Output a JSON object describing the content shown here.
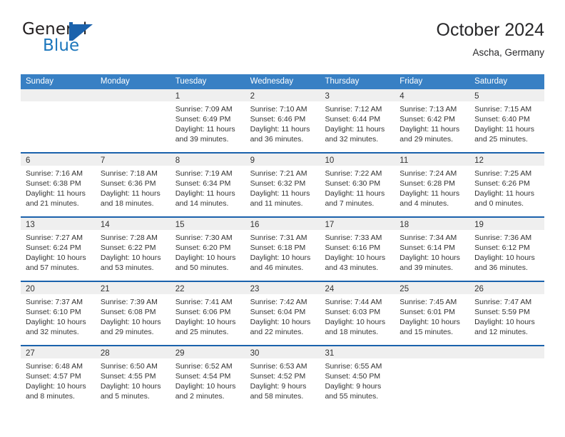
{
  "brand": {
    "name_part1": "General",
    "name_part2": "Blue",
    "logo_icon": "blue-triangle-logo",
    "accent_color": "#1b76bc"
  },
  "header": {
    "title": "October 2024",
    "subtitle": "Ascha, Germany"
  },
  "colors": {
    "header_row_bg": "#3880c4",
    "row_divider": "#1b62ac",
    "day_band_bg": "#efefef",
    "text": "#333333"
  },
  "calendar": {
    "weekdays": [
      "Sunday",
      "Monday",
      "Tuesday",
      "Wednesday",
      "Thursday",
      "Friday",
      "Saturday"
    ],
    "weeks": [
      [
        {
          "day": "",
          "empty": true
        },
        {
          "day": "",
          "empty": true
        },
        {
          "day": "1",
          "sunrise": "Sunrise: 7:09 AM",
          "sunset": "Sunset: 6:49 PM",
          "daylight_1": "Daylight: 11 hours",
          "daylight_2": "and 39 minutes."
        },
        {
          "day": "2",
          "sunrise": "Sunrise: 7:10 AM",
          "sunset": "Sunset: 6:46 PM",
          "daylight_1": "Daylight: 11 hours",
          "daylight_2": "and 36 minutes."
        },
        {
          "day": "3",
          "sunrise": "Sunrise: 7:12 AM",
          "sunset": "Sunset: 6:44 PM",
          "daylight_1": "Daylight: 11 hours",
          "daylight_2": "and 32 minutes."
        },
        {
          "day": "4",
          "sunrise": "Sunrise: 7:13 AM",
          "sunset": "Sunset: 6:42 PM",
          "daylight_1": "Daylight: 11 hours",
          "daylight_2": "and 29 minutes."
        },
        {
          "day": "5",
          "sunrise": "Sunrise: 7:15 AM",
          "sunset": "Sunset: 6:40 PM",
          "daylight_1": "Daylight: 11 hours",
          "daylight_2": "and 25 minutes."
        }
      ],
      [
        {
          "day": "6",
          "sunrise": "Sunrise: 7:16 AM",
          "sunset": "Sunset: 6:38 PM",
          "daylight_1": "Daylight: 11 hours",
          "daylight_2": "and 21 minutes."
        },
        {
          "day": "7",
          "sunrise": "Sunrise: 7:18 AM",
          "sunset": "Sunset: 6:36 PM",
          "daylight_1": "Daylight: 11 hours",
          "daylight_2": "and 18 minutes."
        },
        {
          "day": "8",
          "sunrise": "Sunrise: 7:19 AM",
          "sunset": "Sunset: 6:34 PM",
          "daylight_1": "Daylight: 11 hours",
          "daylight_2": "and 14 minutes."
        },
        {
          "day": "9",
          "sunrise": "Sunrise: 7:21 AM",
          "sunset": "Sunset: 6:32 PM",
          "daylight_1": "Daylight: 11 hours",
          "daylight_2": "and 11 minutes."
        },
        {
          "day": "10",
          "sunrise": "Sunrise: 7:22 AM",
          "sunset": "Sunset: 6:30 PM",
          "daylight_1": "Daylight: 11 hours",
          "daylight_2": "and 7 minutes."
        },
        {
          "day": "11",
          "sunrise": "Sunrise: 7:24 AM",
          "sunset": "Sunset: 6:28 PM",
          "daylight_1": "Daylight: 11 hours",
          "daylight_2": "and 4 minutes."
        },
        {
          "day": "12",
          "sunrise": "Sunrise: 7:25 AM",
          "sunset": "Sunset: 6:26 PM",
          "daylight_1": "Daylight: 11 hours",
          "daylight_2": "and 0 minutes."
        }
      ],
      [
        {
          "day": "13",
          "sunrise": "Sunrise: 7:27 AM",
          "sunset": "Sunset: 6:24 PM",
          "daylight_1": "Daylight: 10 hours",
          "daylight_2": "and 57 minutes."
        },
        {
          "day": "14",
          "sunrise": "Sunrise: 7:28 AM",
          "sunset": "Sunset: 6:22 PM",
          "daylight_1": "Daylight: 10 hours",
          "daylight_2": "and 53 minutes."
        },
        {
          "day": "15",
          "sunrise": "Sunrise: 7:30 AM",
          "sunset": "Sunset: 6:20 PM",
          "daylight_1": "Daylight: 10 hours",
          "daylight_2": "and 50 minutes."
        },
        {
          "day": "16",
          "sunrise": "Sunrise: 7:31 AM",
          "sunset": "Sunset: 6:18 PM",
          "daylight_1": "Daylight: 10 hours",
          "daylight_2": "and 46 minutes."
        },
        {
          "day": "17",
          "sunrise": "Sunrise: 7:33 AM",
          "sunset": "Sunset: 6:16 PM",
          "daylight_1": "Daylight: 10 hours",
          "daylight_2": "and 43 minutes."
        },
        {
          "day": "18",
          "sunrise": "Sunrise: 7:34 AM",
          "sunset": "Sunset: 6:14 PM",
          "daylight_1": "Daylight: 10 hours",
          "daylight_2": "and 39 minutes."
        },
        {
          "day": "19",
          "sunrise": "Sunrise: 7:36 AM",
          "sunset": "Sunset: 6:12 PM",
          "daylight_1": "Daylight: 10 hours",
          "daylight_2": "and 36 minutes."
        }
      ],
      [
        {
          "day": "20",
          "sunrise": "Sunrise: 7:37 AM",
          "sunset": "Sunset: 6:10 PM",
          "daylight_1": "Daylight: 10 hours",
          "daylight_2": "and 32 minutes."
        },
        {
          "day": "21",
          "sunrise": "Sunrise: 7:39 AM",
          "sunset": "Sunset: 6:08 PM",
          "daylight_1": "Daylight: 10 hours",
          "daylight_2": "and 29 minutes."
        },
        {
          "day": "22",
          "sunrise": "Sunrise: 7:41 AM",
          "sunset": "Sunset: 6:06 PM",
          "daylight_1": "Daylight: 10 hours",
          "daylight_2": "and 25 minutes."
        },
        {
          "day": "23",
          "sunrise": "Sunrise: 7:42 AM",
          "sunset": "Sunset: 6:04 PM",
          "daylight_1": "Daylight: 10 hours",
          "daylight_2": "and 22 minutes."
        },
        {
          "day": "24",
          "sunrise": "Sunrise: 7:44 AM",
          "sunset": "Sunset: 6:03 PM",
          "daylight_1": "Daylight: 10 hours",
          "daylight_2": "and 18 minutes."
        },
        {
          "day": "25",
          "sunrise": "Sunrise: 7:45 AM",
          "sunset": "Sunset: 6:01 PM",
          "daylight_1": "Daylight: 10 hours",
          "daylight_2": "and 15 minutes."
        },
        {
          "day": "26",
          "sunrise": "Sunrise: 7:47 AM",
          "sunset": "Sunset: 5:59 PM",
          "daylight_1": "Daylight: 10 hours",
          "daylight_2": "and 12 minutes."
        }
      ],
      [
        {
          "day": "27",
          "sunrise": "Sunrise: 6:48 AM",
          "sunset": "Sunset: 4:57 PM",
          "daylight_1": "Daylight: 10 hours",
          "daylight_2": "and 8 minutes."
        },
        {
          "day": "28",
          "sunrise": "Sunrise: 6:50 AM",
          "sunset": "Sunset: 4:55 PM",
          "daylight_1": "Daylight: 10 hours",
          "daylight_2": "and 5 minutes."
        },
        {
          "day": "29",
          "sunrise": "Sunrise: 6:52 AM",
          "sunset": "Sunset: 4:54 PM",
          "daylight_1": "Daylight: 10 hours",
          "daylight_2": "and 2 minutes."
        },
        {
          "day": "30",
          "sunrise": "Sunrise: 6:53 AM",
          "sunset": "Sunset: 4:52 PM",
          "daylight_1": "Daylight: 9 hours",
          "daylight_2": "and 58 minutes."
        },
        {
          "day": "31",
          "sunrise": "Sunrise: 6:55 AM",
          "sunset": "Sunset: 4:50 PM",
          "daylight_1": "Daylight: 9 hours",
          "daylight_2": "and 55 minutes."
        },
        {
          "day": "",
          "empty": true
        },
        {
          "day": "",
          "empty": true
        }
      ]
    ]
  }
}
